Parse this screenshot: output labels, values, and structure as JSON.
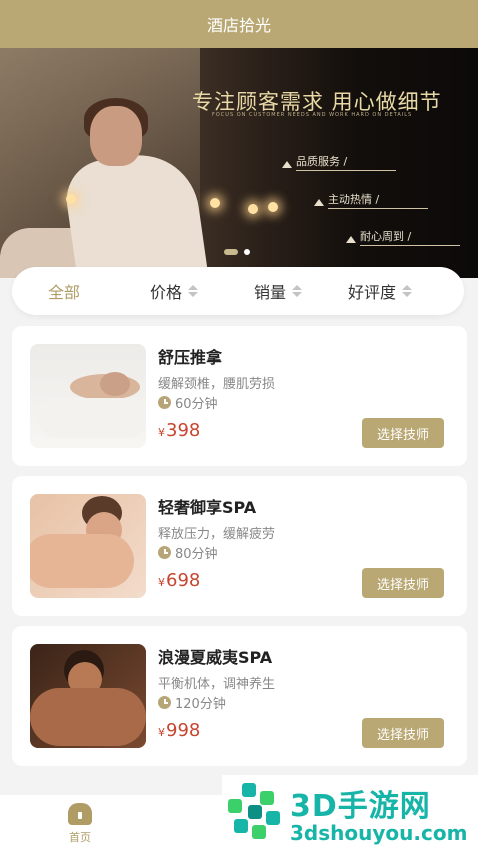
{
  "header": {
    "title": "酒店拾光"
  },
  "banner": {
    "headline": "专注顾客需求 用心做细节",
    "subline": "FOCUS ON CUSTOMER NEEDS AND WORK HARD ON DETAILS",
    "tags": [
      "品质服务 /",
      "主动热情 /",
      "耐心周到 /"
    ],
    "slide_count": 2,
    "active_slide": 1
  },
  "filter": {
    "items": [
      {
        "label": "全部",
        "active": true
      },
      {
        "label": "价格",
        "sortable": true
      },
      {
        "label": "销量",
        "sortable": true
      },
      {
        "label": "好评度",
        "sortable": true
      }
    ]
  },
  "services": [
    {
      "title": "舒压推拿",
      "desc": "缓解颈椎，腰肌劳损",
      "duration": "60分钟",
      "currency": "¥",
      "price": "398",
      "button": "选择技师"
    },
    {
      "title": "轻奢御享SPA",
      "desc": "释放压力，缓解疲劳",
      "duration": "80分钟",
      "currency": "¥",
      "price": "698",
      "button": "选择技师"
    },
    {
      "title": "浪漫夏威夷SPA",
      "desc": "平衡机体，调神养生",
      "duration": "120分钟",
      "currency": "¥",
      "price": "998",
      "button": "选择技师"
    }
  ],
  "tabbar": {
    "items": [
      {
        "label": "首页",
        "icon": "home-icon",
        "active": true
      }
    ]
  },
  "watermark": {
    "brand": "3D手游网",
    "url": "3dshouyou.com"
  },
  "colors": {
    "accent": "#b9a874",
    "price": "#c8452f",
    "watermark": "#17b5a8"
  }
}
